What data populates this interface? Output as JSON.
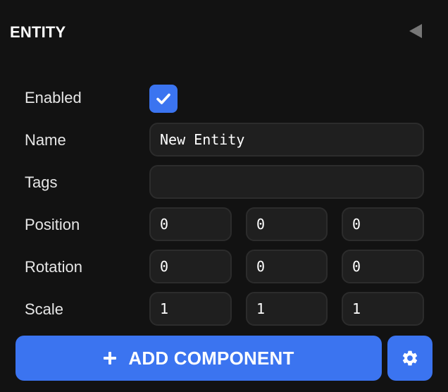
{
  "header": {
    "title": "ENTITY",
    "collapse_icon": "triangle-left-icon"
  },
  "fields": {
    "enabled": {
      "label": "Enabled",
      "checked": true
    },
    "name": {
      "label": "Name",
      "value": "New Entity"
    },
    "tags": {
      "label": "Tags",
      "value": ""
    },
    "position": {
      "label": "Position",
      "x": "0",
      "y": "0",
      "z": "0"
    },
    "rotation": {
      "label": "Rotation",
      "x": "0",
      "y": "0",
      "z": "0"
    },
    "scale": {
      "label": "Scale",
      "x": "1",
      "y": "1",
      "z": "1"
    }
  },
  "actions": {
    "add_component_label": "ADD COMPONENT",
    "add_icon": "plus-icon",
    "settings_icon": "gear-icon"
  },
  "colors": {
    "background": "#121212",
    "field_background": "#1f1f1f",
    "field_border": "#2c2c2c",
    "accent": "#3b74f0",
    "text": "#e6e6e6"
  }
}
